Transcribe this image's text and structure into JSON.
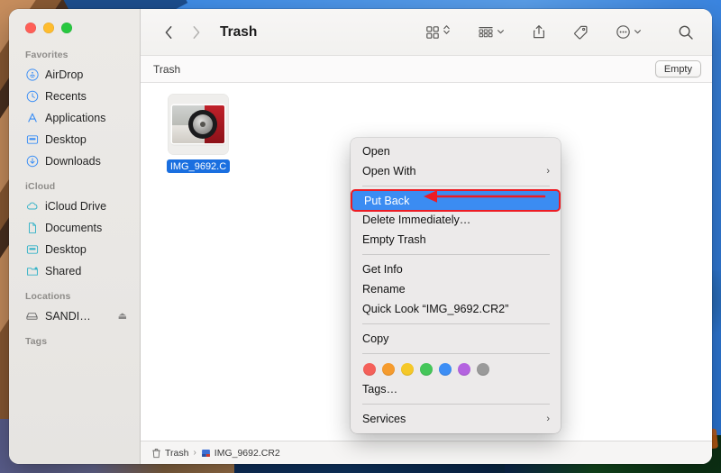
{
  "window": {
    "title": "Trash",
    "traffic_lights": [
      "close",
      "minimize",
      "maximize"
    ]
  },
  "sidebar": {
    "groups": [
      {
        "heading": "Favorites",
        "items": [
          {
            "label": "AirDrop",
            "icon": "airdrop-icon"
          },
          {
            "label": "Recents",
            "icon": "clock-icon"
          },
          {
            "label": "Applications",
            "icon": "applications-icon"
          },
          {
            "label": "Desktop",
            "icon": "desktop-icon"
          },
          {
            "label": "Downloads",
            "icon": "downloads-icon"
          }
        ]
      },
      {
        "heading": "iCloud",
        "items": [
          {
            "label": "iCloud Drive",
            "icon": "cloud-icon"
          },
          {
            "label": "Documents",
            "icon": "document-icon"
          },
          {
            "label": "Desktop",
            "icon": "desktop-icon"
          },
          {
            "label": "Shared",
            "icon": "shared-folder-icon"
          }
        ]
      },
      {
        "heading": "Locations",
        "items": [
          {
            "label": "SANDI…",
            "icon": "external-drive-icon",
            "eject": "⏏"
          }
        ]
      },
      {
        "heading": "Tags",
        "items": []
      }
    ]
  },
  "toolbar": {
    "back_label": "‹",
    "forward_label": "›",
    "title": "Trash",
    "icons": [
      "grid-view-icon",
      "view-options-chevron-icon",
      "group-by-icon",
      "group-chevron-icon",
      "share-icon",
      "tag-icon",
      "more-actions-icon",
      "more-chevron-icon",
      "search-icon"
    ]
  },
  "subbar": {
    "title": "Trash",
    "empty_label": "Empty"
  },
  "content": {
    "file": {
      "name": "IMG_9692.C",
      "full_name": "IMG_9692.CR2",
      "selected": true,
      "thumbnail": "car-wheel-photo"
    }
  },
  "pathbar": {
    "items": [
      {
        "label": "Trash",
        "icon": "trash-icon"
      },
      {
        "label": "IMG_9692.CR2",
        "icon": "raw-file-icon"
      }
    ],
    "separator": "›"
  },
  "context_menu": {
    "sections": [
      {
        "items": [
          {
            "label": "Open",
            "submenu": false,
            "selected": false
          },
          {
            "label": "Open With",
            "submenu": true,
            "selected": false
          }
        ]
      },
      {
        "items": [
          {
            "label": "Put Back",
            "submenu": false,
            "selected": true
          },
          {
            "label": "Delete Immediately…",
            "submenu": false,
            "selected": false
          },
          {
            "label": "Empty Trash",
            "submenu": false,
            "selected": false
          }
        ]
      },
      {
        "items": [
          {
            "label": "Get Info",
            "submenu": false,
            "selected": false
          },
          {
            "label": "Rename",
            "submenu": false,
            "selected": false
          },
          {
            "label": "Quick Look “IMG_9692.CR2”",
            "submenu": false,
            "selected": false
          }
        ]
      },
      {
        "items": [
          {
            "label": "Copy",
            "submenu": false,
            "selected": false
          }
        ]
      }
    ],
    "tags": {
      "colors": [
        "#f4605a",
        "#f59b2e",
        "#f5c828",
        "#45c65a",
        "#3d8ef5",
        "#b463e0",
        "#9a9a9a"
      ],
      "label": "Tags…"
    },
    "services": {
      "label": "Services",
      "submenu": true
    },
    "highlight_color": "#3b8cf2",
    "annotation_color": "#ed1c24"
  },
  "annotation": {
    "arrow": "left-pointing-arrow",
    "color": "#ed1c24"
  }
}
